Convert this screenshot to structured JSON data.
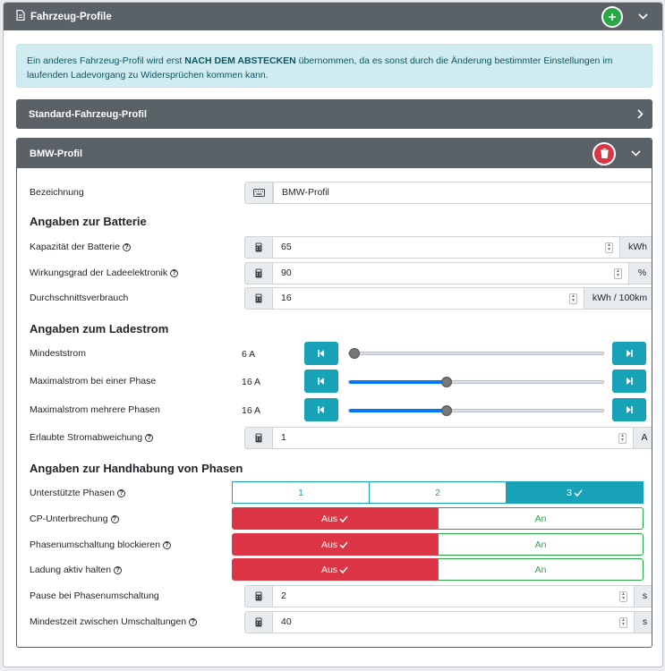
{
  "header": {
    "title": "Fahrzeug-Profile"
  },
  "alert": {
    "pre": "Ein anderes Fahrzeug-Profil wird erst ",
    "bold": "NACH DEM ABSTECKEN",
    "post": " übernommen, da es sonst durch die Änderung bestimmter Einstellungen im laufenden Ladevorgang zu Widersprüchen kommen kann."
  },
  "standard_profile": {
    "title": "Standard-Fahrzeug-Profil"
  },
  "bmw_profile": {
    "title": "BMW-Profil",
    "name": {
      "label": "Bezeichnung",
      "value": "BMW-Profil"
    },
    "battery": {
      "heading": "Angaben zur Batterie",
      "capacity": {
        "label": "Kapazität der Batterie",
        "value": "65",
        "unit": "kWh"
      },
      "efficiency": {
        "label": "Wirkungsgrad der Ladeelektronik",
        "value": "90",
        "unit": "%"
      },
      "consumption": {
        "label": "Durchschnittsverbrauch",
        "value": "16",
        "unit": "kWh / 100km"
      }
    },
    "current": {
      "heading": "Angaben zum Ladestrom",
      "min": {
        "label": "Mindeststrom",
        "value": "6 A",
        "level": 0
      },
      "max_one": {
        "label": "Maximalstrom bei einer Phase",
        "value": "16 A",
        "level": 0.38
      },
      "max_multi": {
        "label": "Maximalstrom mehrere Phasen",
        "value": "16 A",
        "level": 0.38
      },
      "deviation": {
        "label": "Erlaubte Stromabweichung",
        "value": "1",
        "unit": "A"
      }
    },
    "phases": {
      "heading": "Angaben zur Handhabung von Phasen",
      "supported": {
        "label": "Unterstützte Phasen",
        "options": [
          "1",
          "2",
          "3"
        ],
        "selected": "3"
      },
      "cp_interrupt": {
        "label": "CP-Unterbrechung",
        "off": "Aus",
        "on": "An"
      },
      "block_switch": {
        "label": "Phasenumschaltung blockieren",
        "off": "Aus",
        "on": "An"
      },
      "keep_active": {
        "label": "Ladung aktiv halten",
        "off": "Aus",
        "on": "An"
      },
      "pause": {
        "label": "Pause bei Phasenumschaltung",
        "value": "2",
        "unit": "s"
      },
      "min_time": {
        "label": "Mindestzeit zwischen Umschaltungen",
        "value": "40",
        "unit": "s"
      }
    }
  },
  "colors": {
    "header": "#5a6268",
    "info": "#17a2b8",
    "danger": "#dc3545",
    "success": "#28a745"
  },
  "icons": [
    "file-icon",
    "plus-icon",
    "chevron-down-icon",
    "chevron-right-icon",
    "trash-icon",
    "keyboard-icon",
    "calculator-icon",
    "step-backward-icon",
    "step-forward-icon",
    "question-circle-icon",
    "check-icon"
  ]
}
